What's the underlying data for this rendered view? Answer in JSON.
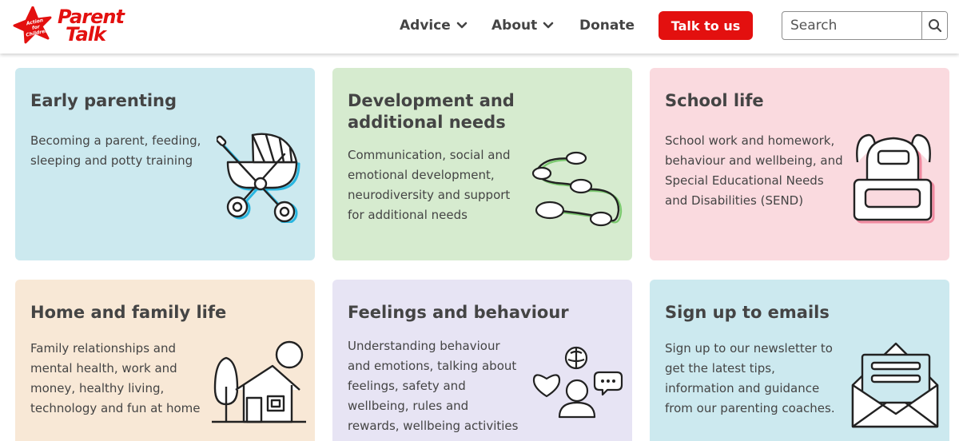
{
  "logo": {
    "word1": "Parent",
    "word2": "Talk",
    "star_text": "Action for Children"
  },
  "nav": {
    "advice": "Advice",
    "about": "About",
    "donate": "Donate",
    "talk_button": "Talk to us",
    "search_placeholder": "Search"
  },
  "cards": [
    {
      "title": "Early parenting",
      "description": "Becoming a parent, feeding, sleeping and potty training",
      "icon": "pram-icon",
      "color": "#cce9ef"
    },
    {
      "title": "Development and additional needs",
      "description": "Communication, social and emotional development, neurodiversity and support for additional needs",
      "icon": "milestones-path-icon",
      "color": "#d6ebcf"
    },
    {
      "title": "School life",
      "description": "School work and homework, behaviour and wellbeing, and Special Educational Needs and Disabilities (SEND)",
      "icon": "backpack-icon",
      "color": "#fadadf"
    },
    {
      "title": "Home and family life",
      "description": "Family relationships and mental health, work and money, healthy living, technology and fun at home",
      "icon": "house-icon",
      "color": "#f8e8d6"
    },
    {
      "title": "Feelings and behaviour",
      "description": "Understanding behaviour and emotions, talking about feelings, safety and wellbeing, rules and rewards, wellbeing activities",
      "icon": "feelings-icon",
      "color": "#e7e4f4"
    },
    {
      "title": "Sign up to emails",
      "description": "Sign up to our newsletter to get the latest tips, information and guidance from our parenting coaches.",
      "icon": "envelope-icon",
      "color": "#cce9ef"
    }
  ],
  "colors": {
    "brand_red": "#e3100f",
    "text": "#444444"
  }
}
